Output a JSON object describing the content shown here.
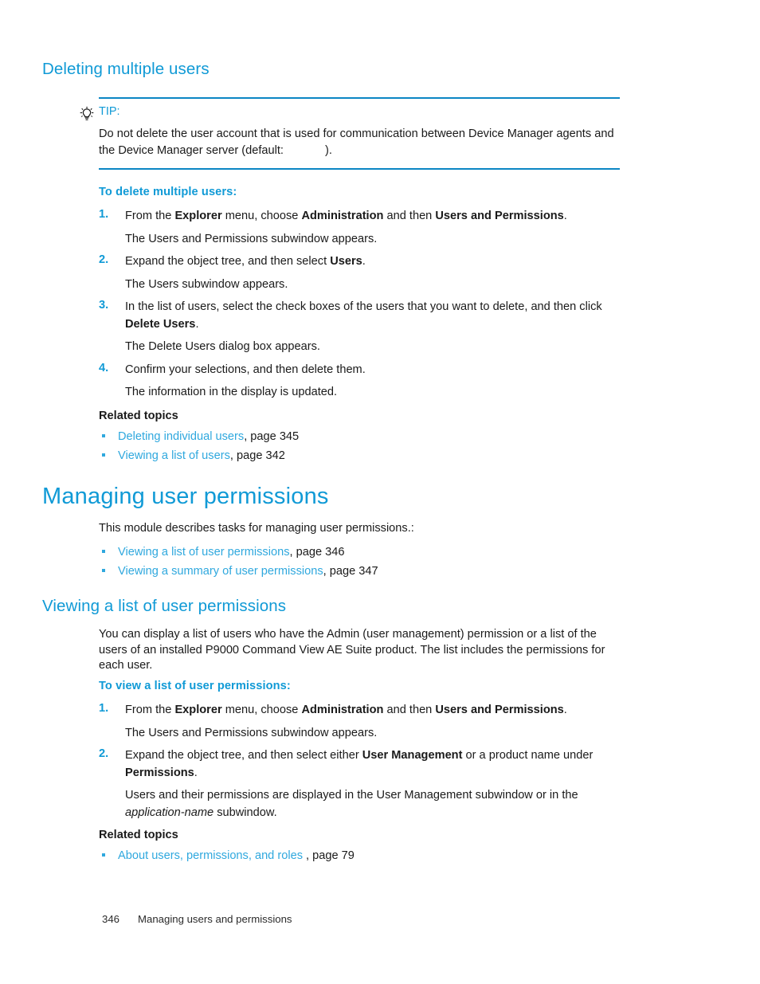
{
  "colors": {
    "heading_blue": "#109AD6",
    "link_blue": "#2FA8DE",
    "rule_blue": "#0B86C4",
    "body_black": "#1a1a1a"
  },
  "section_heading": "Deleting multiple users",
  "tip": {
    "icon": "lightbulb-icon",
    "label": "TIP:",
    "text_before": "Do not delete the user account that is used for communication between Device Manager agents and the Device Manager server (default:",
    "redacted_value": "",
    "text_after": ")."
  },
  "procedure_delete": {
    "title": "To delete multiple users:",
    "steps": [
      {
        "number": "1.",
        "parts": [
          {
            "text": "From the ",
            "bold": false
          },
          {
            "text": "Explorer",
            "bold": true
          },
          {
            "text": " menu, choose ",
            "bold": false
          },
          {
            "text": "Administration",
            "bold": true
          },
          {
            "text": " and then ",
            "bold": false
          },
          {
            "text": "Users and Permissions",
            "bold": true
          },
          {
            "text": ".",
            "bold": false
          }
        ],
        "result": "The Users and Permissions subwindow appears."
      },
      {
        "number": "2.",
        "parts": [
          {
            "text": "Expand the object tree, and then select ",
            "bold": false
          },
          {
            "text": "Users",
            "bold": true
          },
          {
            "text": ".",
            "bold": false
          }
        ],
        "result": "The Users subwindow appears."
      },
      {
        "number": "3.",
        "parts": [
          {
            "text": "In the list of users, select the check boxes of the users that you want to delete, and then click ",
            "bold": false
          },
          {
            "text": "Delete Users",
            "bold": true
          },
          {
            "text": ".",
            "bold": false
          }
        ],
        "result": "The Delete Users dialog box appears."
      },
      {
        "number": "4.",
        "parts": [
          {
            "text": "Confirm your selections, and then delete them.",
            "bold": false
          }
        ],
        "result": "The information in the display is updated."
      }
    ]
  },
  "related_topics_1": {
    "title": "Related topics",
    "items": [
      {
        "link": "Deleting individual users",
        "suffix": ", page 345"
      },
      {
        "link": "Viewing a list of users",
        "suffix": ", page 342"
      }
    ]
  },
  "chapter_heading": "Managing user permissions",
  "chapter_intro": "This module describes tasks for managing user permissions.:",
  "chapter_links": [
    {
      "link": "Viewing a list of user permissions",
      "suffix": ", page 346"
    },
    {
      "link": "Viewing a summary of user permissions",
      "suffix": ", page 347"
    }
  ],
  "topic_heading": "Viewing a list of user permissions",
  "topic_body": "You can display a list of users who have the Admin (user management) permission or a list of the users of an installed P9000 Command View AE Suite product. The list includes the permissions for each user.",
  "procedure_view": {
    "title": "To view a list of user permissions:",
    "steps": [
      {
        "number": "1.",
        "parts": [
          {
            "text": "From the ",
            "bold": false
          },
          {
            "text": "Explorer",
            "bold": true
          },
          {
            "text": " menu, choose ",
            "bold": false
          },
          {
            "text": "Administration",
            "bold": true
          },
          {
            "text": " and then ",
            "bold": false
          },
          {
            "text": "Users and Permissions",
            "bold": true
          },
          {
            "text": ".",
            "bold": false
          }
        ],
        "result": "The Users and Permissions subwindow appears."
      },
      {
        "number": "2.",
        "parts": [
          {
            "text": "Expand the object tree, and then select either ",
            "bold": false
          },
          {
            "text": "User Management",
            "bold": true
          },
          {
            "text": " or a product name under ",
            "bold": false
          },
          {
            "text": "Permissions",
            "bold": true
          },
          {
            "text": ".",
            "bold": false
          }
        ],
        "result_parts": [
          {
            "text": "Users and their permissions are displayed in the User Management subwindow or in the ",
            "italic": false
          },
          {
            "text": "application-name",
            "italic": true
          },
          {
            "text": " subwindow.",
            "italic": false
          }
        ]
      }
    ]
  },
  "related_topics_2": {
    "title": "Related topics",
    "items": [
      {
        "link": "About users, permissions, and roles ",
        "suffix": ", page 79"
      }
    ]
  },
  "footer": {
    "page_number": "346",
    "chapter_name": "Managing users and permissions"
  }
}
